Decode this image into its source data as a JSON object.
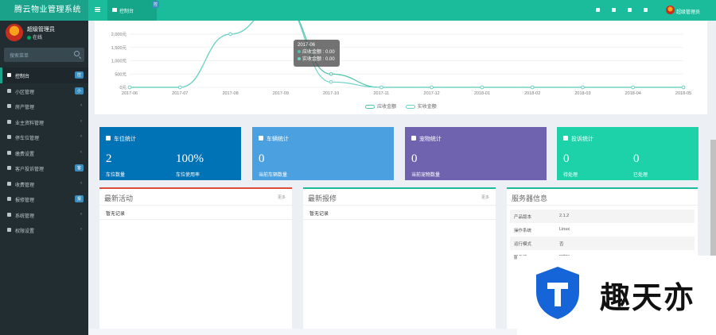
{
  "app": {
    "title": "腾云物业管理系统"
  },
  "user": {
    "name": "超级管理员",
    "status": "在线"
  },
  "search": {
    "placeholder": "搜索菜单"
  },
  "menu": [
    {
      "label": "控制台",
      "badge": "控",
      "active": true
    },
    {
      "label": "小区管理",
      "badge": "小"
    },
    {
      "label": "房产管理",
      "caret": "‹"
    },
    {
      "label": "业主资料管理",
      "caret": "‹"
    },
    {
      "label": "停车位管理",
      "caret": "‹"
    },
    {
      "label": "缴费设置",
      "caret": "‹"
    },
    {
      "label": "客户投诉管理",
      "badge": "客"
    },
    {
      "label": "收费管理",
      "caret": "‹"
    },
    {
      "label": "报修管理",
      "badge": "报"
    },
    {
      "label": "系统管理",
      "caret": "‹"
    },
    {
      "label": "权限设置",
      "caret": "‹"
    }
  ],
  "navbar": {
    "tab_label": "控制台",
    "tab_badge": "控",
    "user_name": "超级管理员"
  },
  "chart_data": {
    "type": "line",
    "x": [
      "2017-06",
      "2017-07",
      "2017-08",
      "2017-09",
      "2017-10",
      "2017-11",
      "2017-12",
      "2018-01",
      "2018-02",
      "2018-03",
      "2018-04",
      "2018-05"
    ],
    "y_ticks": [
      "0元",
      "500元",
      "1,000元",
      "1,500元",
      "2,000元"
    ],
    "ylim": [
      0,
      2500
    ],
    "series": [
      {
        "name": "应收金额",
        "values": [
          0,
          0,
          2000,
          3200,
          500,
          0,
          0,
          0,
          0,
          0,
          0,
          0
        ],
        "color": "#4fc3a8"
      },
      {
        "name": "实收金额",
        "values": [
          0,
          0,
          2000,
          3200,
          200,
          0,
          0,
          0,
          0,
          0,
          0,
          0
        ],
        "color": "#6fd3c8"
      }
    ],
    "tooltip": {
      "title": "2017-06",
      "rows": [
        "应收金额 : 0.00",
        "实收金额 : 0.00"
      ]
    },
    "legend_position": "bottom"
  },
  "cards": [
    {
      "title": "车位统计",
      "color": "#0073b7",
      "stats": [
        {
          "value": "2",
          "label": "车位数量"
        },
        {
          "value": "100%",
          "label": "车位使用率"
        }
      ]
    },
    {
      "title": "车辆统计",
      "color": "#4ba1e0",
      "stats": [
        {
          "value": "0",
          "label": "当前车辆数量"
        }
      ]
    },
    {
      "title": "宠物统计",
      "color": "#6f63b0",
      "stats": [
        {
          "value": "0",
          "label": "当前宠物数量"
        }
      ]
    },
    {
      "title": "投诉统计",
      "color": "#1dd2a9",
      "stats": [
        {
          "value": "0",
          "label": "待处理"
        },
        {
          "value": "0",
          "label": "已处理"
        }
      ]
    }
  ],
  "panels": {
    "activity": {
      "title": "最新活动",
      "more": "更多",
      "empty": "暂无记录"
    },
    "repair": {
      "title": "最新报修",
      "more": "更多",
      "empty": "暂无记录"
    },
    "server": {
      "title": "服务器信息",
      "rows": [
        {
          "k": "产品版本",
          "v": "2.1.2"
        },
        {
          "k": "操作系统",
          "v": "Linux"
        },
        {
          "k": "运行模式",
          "v": "否"
        },
        {
          "k": "服务器",
          "v": "nginx"
        }
      ]
    }
  },
  "watermark": {
    "text": "趣天亦"
  }
}
